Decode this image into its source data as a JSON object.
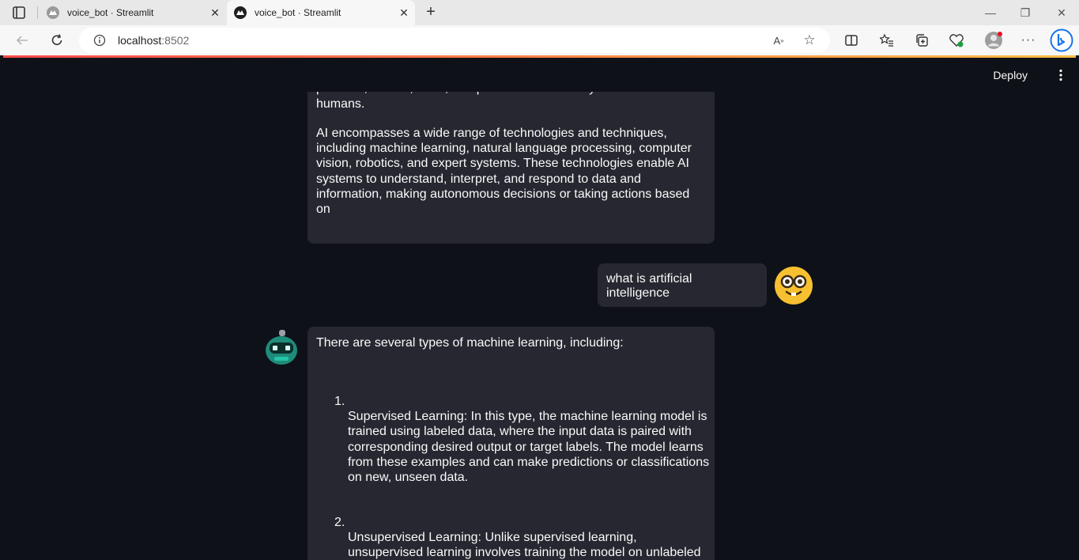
{
  "browser": {
    "tabs": [
      {
        "title": "voice_bot · Streamlit",
        "active": false
      },
      {
        "title": "voice_bot · Streamlit",
        "active": true
      }
    ],
    "address": {
      "host": "localhost",
      "port": ":8502"
    }
  },
  "app": {
    "deploy_label": "Deploy",
    "messages": [
      {
        "role": "assistant",
        "paragraphs": [
          "human intelligence. It involves creating intelligent machines that can perceive, reason, learn, and problem-solve in ways similar to humans.",
          "AI encompasses a wide range of technologies and techniques, including machine learning, natural language processing, computer vision, robotics, and expert systems. These technologies enable AI systems to understand, interpret, and respond to data and information, making autonomous decisions or taking actions based on"
        ]
      },
      {
        "role": "user",
        "text": "what is artificial intelligence"
      },
      {
        "role": "assistant",
        "intro": "There are several types of machine learning, including:",
        "items": [
          {
            "num": "1.",
            "text": "Supervised Learning: In this type, the machine learning model is trained using labeled data, where the input data is paired with corresponding desired output or target labels. The model learns from these examples and can make predictions or classifications on new, unseen data."
          },
          {
            "num": "2.",
            "text": "Unsupervised Learning: Unlike supervised learning, unsupervised learning involves training the model on unlabeled"
          }
        ]
      }
    ]
  },
  "colors": {
    "app_bg": "#0e1117",
    "bubble_bg": "#262730",
    "text": "#fafafa",
    "accent_start": "#ff4b4b",
    "accent_end": "#ffbd45"
  }
}
